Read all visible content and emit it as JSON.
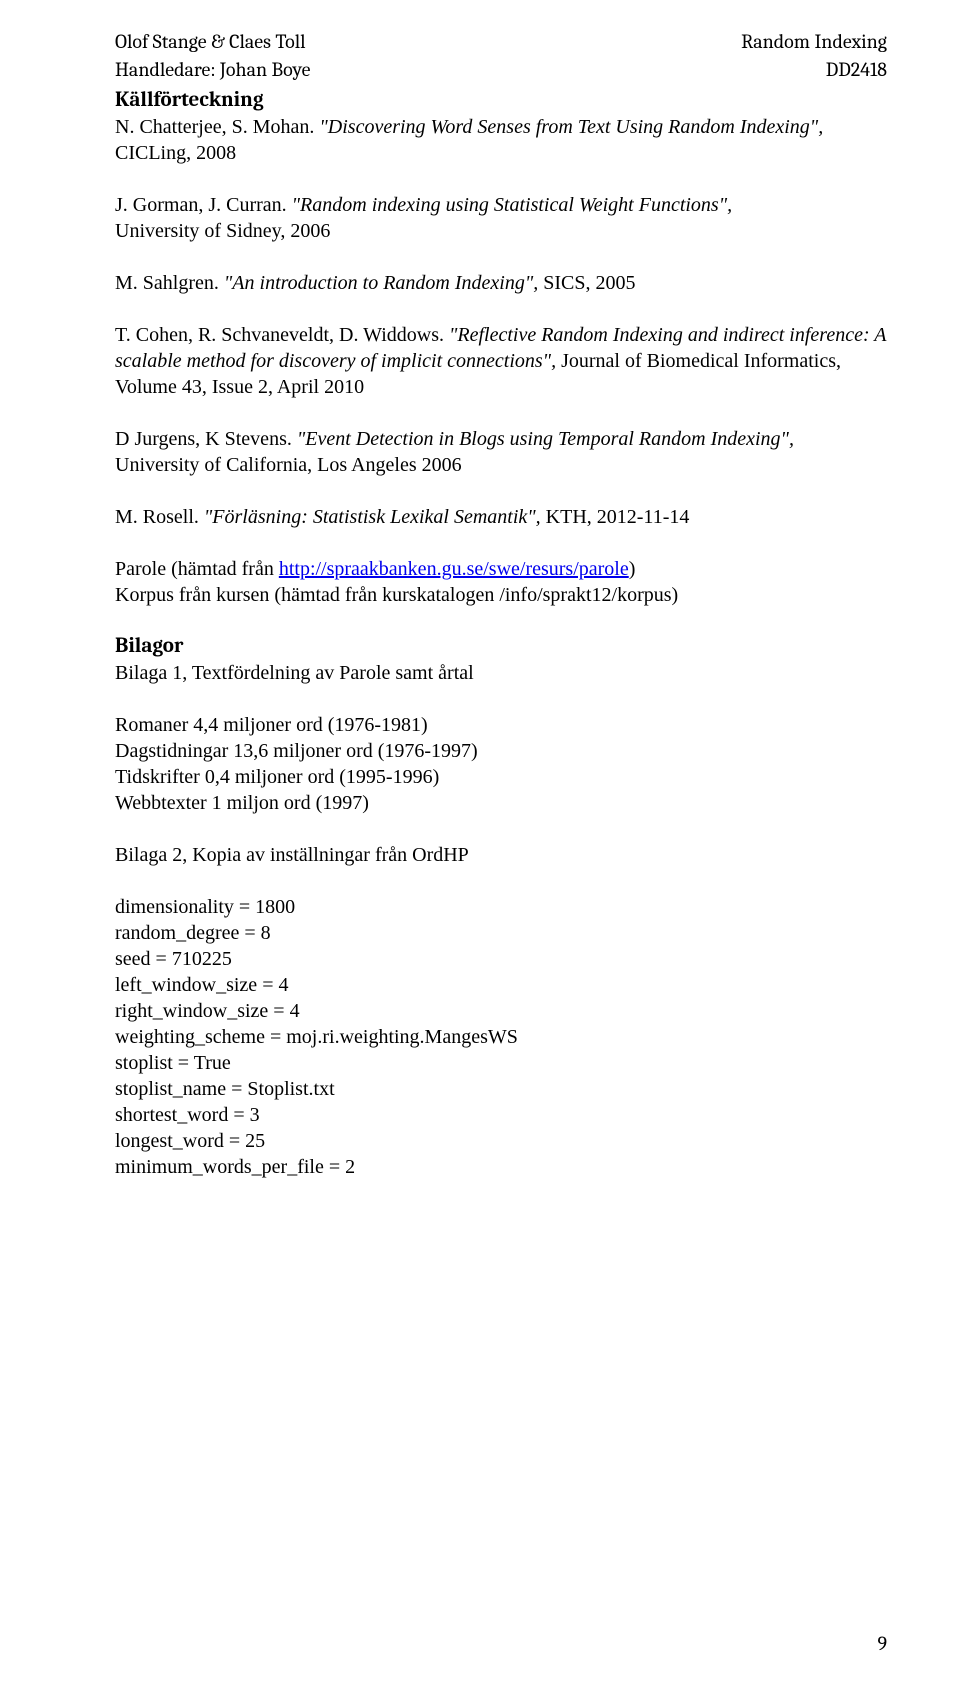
{
  "header": {
    "left1": "Olof Stange & Claes Toll",
    "left2": "Handledare: Johan Boye",
    "right1": "Random Indexing",
    "right2": "DD2418"
  },
  "sections": {
    "bibliography_heading": "Källförteckning",
    "attachments_heading": "Bilagor"
  },
  "refs": {
    "r1a": "N. Chatterjee, S. Mohan. ",
    "r1b": "\"Discovering Word Senses from Text Using Random Indexing\",",
    "r1c": " CICLing, 2008",
    "r2a": "J. Gorman, J. Curran. ",
    "r2b": "\"Random indexing using Statistical Weight Functions\",",
    "r2c": "University of Sidney, 2006",
    "r3a": "M. Sahlgren. ",
    "r3b": "\"An introduction to Random Indexing\",",
    "r3c": " SICS, 2005",
    "r4a": "T. Cohen, R. Schvaneveldt, D. Widdows. ",
    "r4b": "\"Reflective Random Indexing and indirect inference: A scalable method for discovery of implicit connections\", ",
    "r4c": " Journal of Biomedical Informatics, Volume 43, Issue 2, April 2010",
    "r5a": "D Jurgens, K Stevens. ",
    "r5b": "\"Event Detection in Blogs using Temporal Random Indexing\",",
    "r5c": "University of California, Los Angeles 2006",
    "r6a": "M. Rosell. ",
    "r6b": "\"Förläsning: Statistisk Lexikal Semantik\",",
    "r6c": " KTH, 2012-11-14"
  },
  "parole": {
    "p1a": "Parole (hämtad från ",
    "p1link": "http://spraakbanken.gu.se/swe/resurs/parole",
    "p1b": ")",
    "p2": "Korpus från kursen (hämtad från kurskatalogen /info/sprakt12/korpus)"
  },
  "bilaga1": {
    "title": "Bilaga 1, Textfördelning av Parole samt årtal",
    "line1": "Romaner 4,4 miljoner ord (1976-1981)",
    "line2": "Dagstidningar 13,6 miljoner ord (1976-1997)",
    "line3": "Tidskrifter 0,4 miljoner ord (1995-1996)",
    "line4": "Webbtexter 1 miljon ord (1997)"
  },
  "bilaga2": {
    "title": "Bilaga 2, Kopia av inställningar från OrdHP",
    "s1": "dimensionality = 1800",
    "s2": "random_degree  = 8",
    "s3": "seed = 710225",
    "s4": "left_window_size  = 4",
    "s5": "right_window_size = 4",
    "s6": "weighting_scheme = moj.ri.weighting.MangesWS",
    "s7": "stoplist = True",
    "s8": "stoplist_name = Stoplist.txt",
    "s9": "shortest_word = 3",
    "s10": "longest_word = 25",
    "s11": "minimum_words_per_file = 2"
  },
  "page_number": "9"
}
